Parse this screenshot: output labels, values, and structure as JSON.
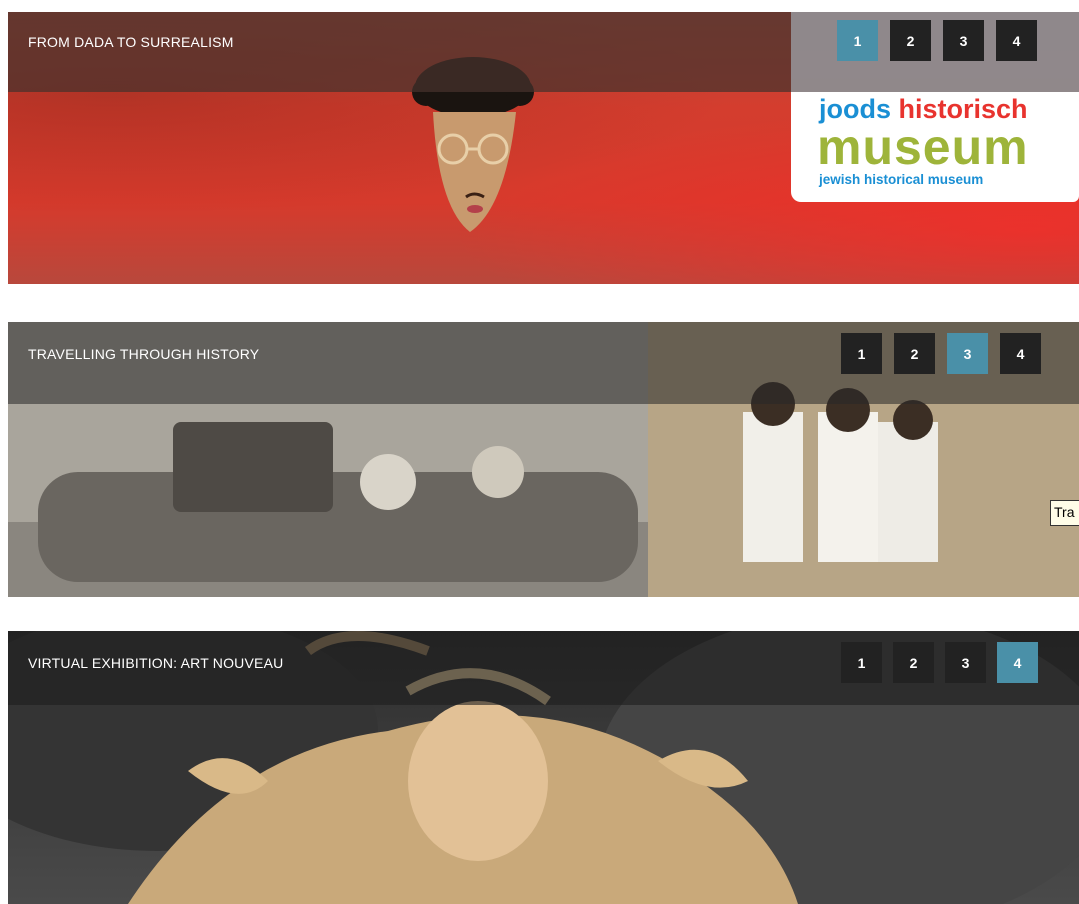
{
  "banners": [
    {
      "caption": "FROM DADA TO SURREALISM",
      "pages": [
        "1",
        "2",
        "3",
        "4"
      ],
      "active_page": 1
    },
    {
      "caption": "TRAVELLING THROUGH HISTORY",
      "pages": [
        "1",
        "2",
        "3",
        "4"
      ],
      "active_page": 3
    },
    {
      "caption": "VIRTUAL EXHIBITION: ART NOUVEAU",
      "pages": [
        "1",
        "2",
        "3",
        "4"
      ],
      "active_page": 4
    }
  ],
  "logo": {
    "line1_a": "joods",
    "line1_b": "historisch",
    "line2": "museum",
    "line3": "jewish historical museum"
  },
  "tooltip": "Tra",
  "colors": {
    "pager_bg": "#222222",
    "pager_active": "#4a90a8",
    "logo_blue": "#1a8fd4",
    "logo_red": "#e8332e",
    "logo_green": "#9eb43a"
  }
}
